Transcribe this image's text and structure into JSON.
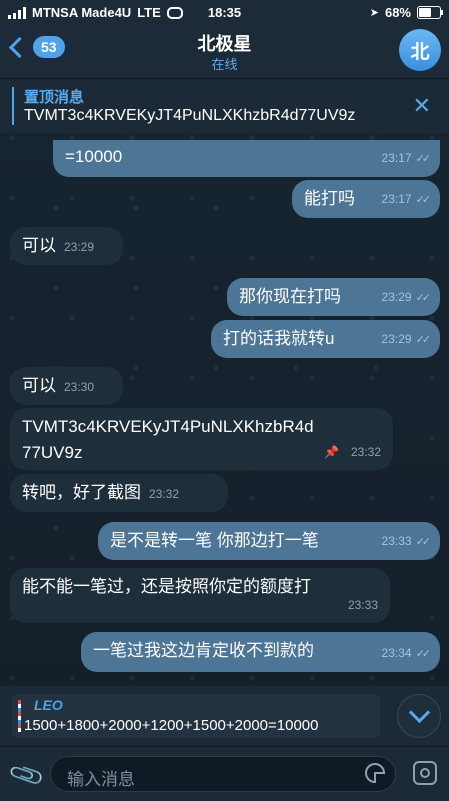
{
  "status_bar": {
    "carrier": "MTNSA Made4U",
    "network": "LTE",
    "time": "18:35",
    "battery_percent": "68%",
    "battery_level": 0.68
  },
  "header": {
    "back_count": "53",
    "title": "北极星",
    "status": "在线",
    "avatar_letter": "北"
  },
  "pinned": {
    "label": "置顶消息",
    "text": "TVMT3c4KRVEKyJT4PuNLXKhzbR4d77UV9z",
    "close_glyph": "✕"
  },
  "messages": [
    {
      "text": "=10000",
      "time": "23:17",
      "dir": "out",
      "ticks": "✓✓"
    },
    {
      "text": "能打吗",
      "time": "23:17",
      "dir": "out",
      "ticks": "✓✓"
    },
    {
      "text": "可以",
      "time": "23:29",
      "dir": "in"
    },
    {
      "text": "那你现在打吗",
      "time": "23:29",
      "dir": "out",
      "ticks": "✓✓"
    },
    {
      "text": "打的话我就转u",
      "time": "23:29",
      "dir": "out",
      "ticks": "✓✓"
    },
    {
      "text": "可以",
      "time": "23:30",
      "dir": "in"
    },
    {
      "text_line1": "TVMT3c4KRVEKyJT4PuNLXKhzbR4d",
      "text_line2": "77UV9z",
      "time": "23:32",
      "dir": "in",
      "pinned": true
    },
    {
      "text": "转吧，好了截图",
      "time": "23:32",
      "dir": "in"
    },
    {
      "text": "是不是转一笔 你那边打一笔",
      "time": "23:33",
      "dir": "out",
      "ticks": "✓✓"
    },
    {
      "text": "能不能一笔过，还是按照你定的额度打",
      "time": "23:33",
      "dir": "in"
    },
    {
      "text": "一笔过我这边肯定收不到款的",
      "time": "23:34",
      "dir": "out",
      "ticks": "✓✓"
    }
  ],
  "reply": {
    "name": "LEO",
    "text": "1500+1800+2000+1200+1500+2000=10000"
  },
  "input": {
    "placeholder": "输入消息"
  },
  "colors": {
    "accent": "#4fa3e8",
    "outgoing_bubble": "#4c7596",
    "incoming_bubble": "#1f2e3b"
  }
}
